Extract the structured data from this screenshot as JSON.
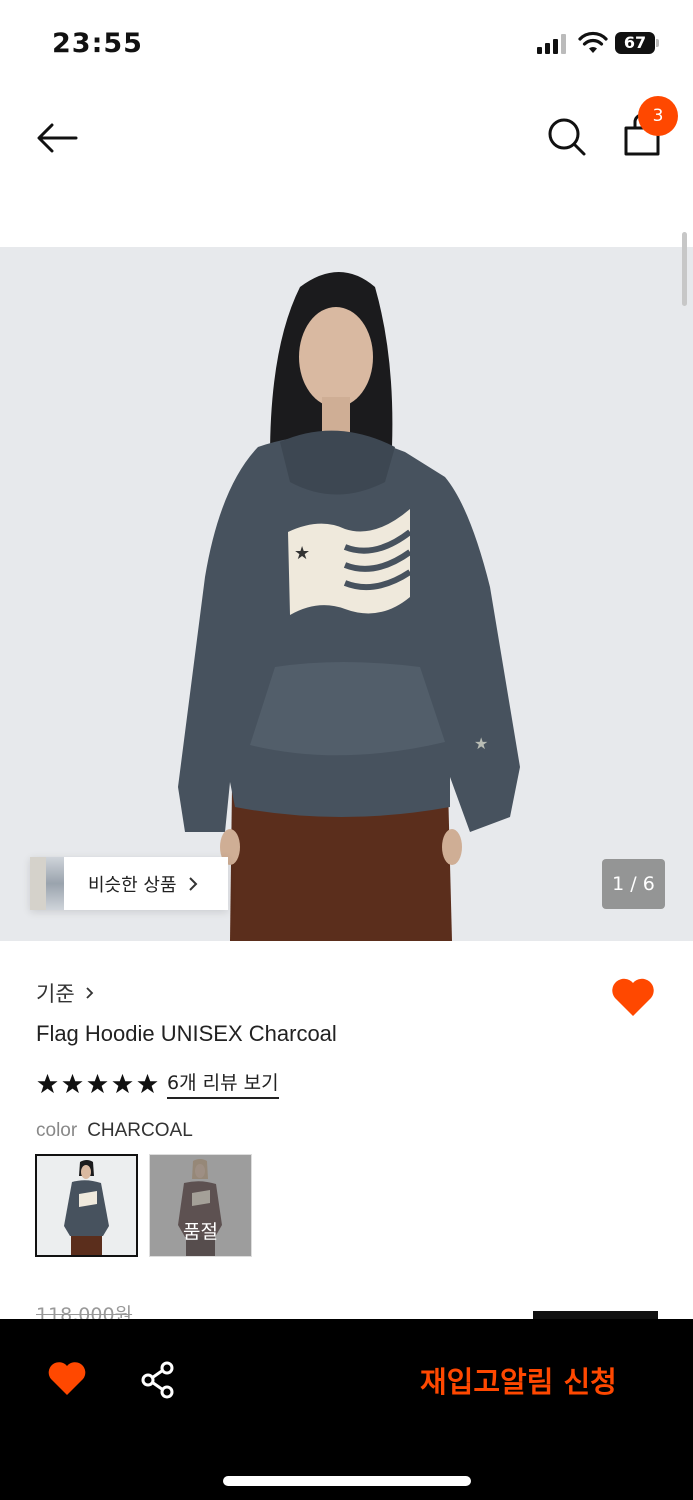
{
  "status_bar": {
    "time": "23:55",
    "battery": "67"
  },
  "header": {
    "cart_count": "3"
  },
  "gallery": {
    "similar_label": "비슷한 상품",
    "page": "1 / 6"
  },
  "product": {
    "brand": "기준",
    "name": "Flag Hoodie UNISEX Charcoal",
    "rating": 5,
    "review_link": "6개 리뷰 보기",
    "color_label": "color",
    "color_value": "CHARCOAL",
    "soldout_label": "품절",
    "original_price": "118,000원"
  },
  "bottom_bar": {
    "restock_label": "재입고알림 신청"
  },
  "colors": {
    "accent": "#ff4800",
    "bar": "#000000"
  }
}
